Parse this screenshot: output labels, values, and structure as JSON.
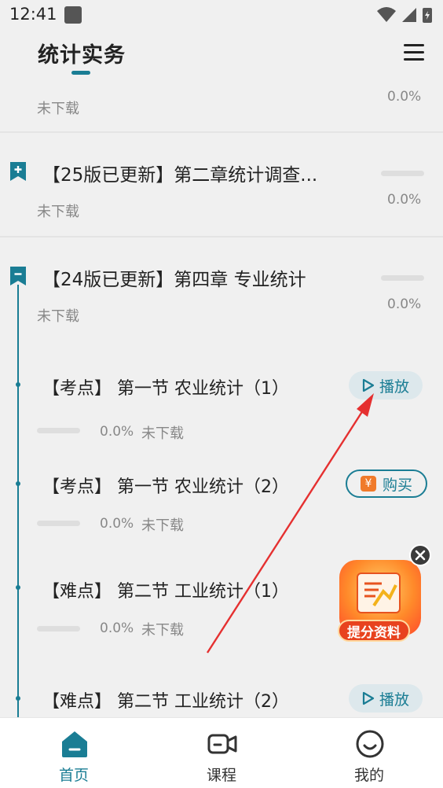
{
  "status_bar": {
    "time": "12:41"
  },
  "header": {
    "title": "统计实务"
  },
  "chapters": [
    {
      "title": "",
      "status": "未下载",
      "percent": "0.0%"
    },
    {
      "title": "【25版已更新】第二章统计调查...",
      "status": "未下载",
      "percent": "0.0%"
    },
    {
      "title": "【24版已更新】第四章 专业统计",
      "status": "未下载",
      "percent": "0.0%"
    }
  ],
  "lessons": [
    {
      "title": "【考点】 第一节 农业统计（1）",
      "percent": "0.0%",
      "status": "未下载",
      "action": "播放"
    },
    {
      "title": "【考点】 第一节 农业统计（2）",
      "percent": "0.0%",
      "status": "未下载",
      "action": "购买"
    },
    {
      "title": "【难点】 第二节 工业统计（1）",
      "percent": "0.0%",
      "status": "未下载",
      "action": ""
    },
    {
      "title": "【难点】 第二节 工业统计（2）",
      "action": "播放"
    }
  ],
  "promo": {
    "label": "提分资料"
  },
  "tab_bar": {
    "tabs": [
      {
        "label": "首页",
        "icon": "home-icon",
        "active": true
      },
      {
        "label": "课程",
        "icon": "video-camera-icon",
        "active": false
      },
      {
        "label": "我的",
        "icon": "smile-face-icon",
        "active": false
      }
    ]
  },
  "colors": {
    "accent": "#1a7d94",
    "promo": "#e8421e",
    "arrow": "#e53030"
  }
}
